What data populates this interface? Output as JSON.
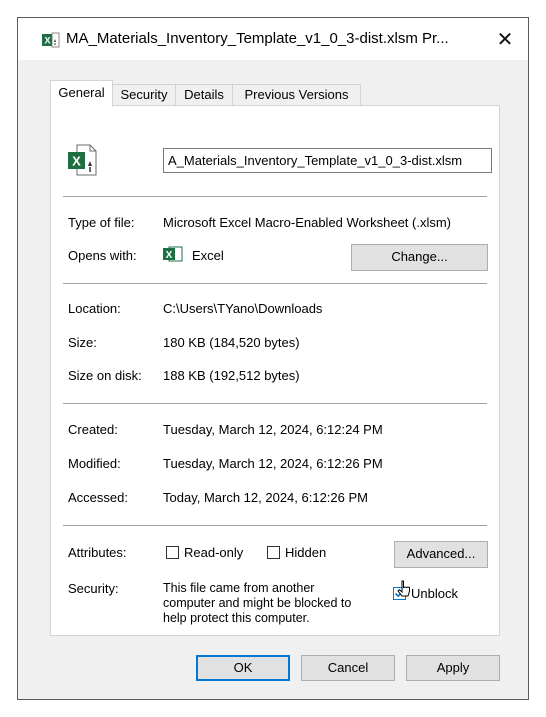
{
  "window": {
    "title": "MA_Materials_Inventory_Template_v1_0_3-dist.xlsm Pr...",
    "close_glyph": "✕"
  },
  "tabs": [
    {
      "label": "General",
      "active": true
    },
    {
      "label": "Security",
      "active": false
    },
    {
      "label": "Details",
      "active": false
    },
    {
      "label": "Previous Versions",
      "active": false
    }
  ],
  "general": {
    "filename": "A_Materials_Inventory_Template_v1_0_3-dist.xlsm",
    "type_label": "Type of file:",
    "type_value": "Microsoft Excel Macro-Enabled Worksheet (.xlsm)",
    "opens_label": "Opens with:",
    "opens_value": "Excel",
    "change_label": "Change...",
    "location_label": "Location:",
    "location_value": "C:\\Users\\TYano\\Downloads",
    "size_label": "Size:",
    "size_value": "180 KB (184,520 bytes)",
    "disk_label": "Size on disk:",
    "disk_value": "188 KB (192,512 bytes)",
    "created_label": "Created:",
    "created_value": "Tuesday, March 12, 2024, 6:12:24 PM",
    "modified_label": "Modified:",
    "modified_value": "Tuesday, March 12, 2024, 6:12:26 PM",
    "accessed_label": "Accessed:",
    "accessed_value": "Today, March 12, 2024, 6:12:26 PM",
    "attributes_label": "Attributes:",
    "readonly_label": "Read-only",
    "hidden_label": "Hidden",
    "advanced_label": "Advanced...",
    "security_label": "Security:",
    "security_line1": "This file came from another",
    "security_line2": "computer and might be blocked to",
    "security_line3": "help protect this computer.",
    "unblock_label": "Unblock",
    "unblock_checked": true
  },
  "footer": {
    "ok_label": "OK",
    "cancel_label": "Cancel",
    "apply_label": "Apply"
  },
  "icons": {
    "title": "excel-macro-file-icon",
    "file": "excel-macro-file-icon",
    "app": "excel-app-icon",
    "close": "close-icon",
    "cursor": "mouse-pointer-icon"
  },
  "colors": {
    "excel_green": "#1d6f42",
    "focus_blue": "#0078d7"
  }
}
